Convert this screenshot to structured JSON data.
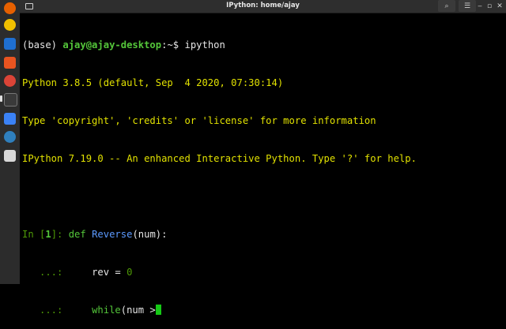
{
  "window": {
    "title": "IPython: home/ajay"
  },
  "dock": {
    "apps": [
      {
        "name": "firefox-icon",
        "color": "#e66000"
      },
      {
        "name": "rhythmbox-icon",
        "color": "#f0c000"
      },
      {
        "name": "libreoffice-writer-icon",
        "color": "#1f6fd0"
      },
      {
        "name": "software-center-icon",
        "color": "#e95420"
      },
      {
        "name": "chrome-icon",
        "color": "#db4437"
      },
      {
        "name": "terminal-icon",
        "color": "#3a3a3a"
      },
      {
        "name": "screenshot-app-icon",
        "color": "#3b82f6"
      },
      {
        "name": "spyder-icon",
        "color": "#2f7fbd"
      },
      {
        "name": "files-icon",
        "color": "#d8d8d8"
      }
    ]
  },
  "terminal": {
    "prompt_env": "(base) ",
    "prompt_user": "ajay@ajay-desktop",
    "prompt_path": ":~$",
    "command": " ipython",
    "banner1": "Python 3.8.5 (default, Sep  4 2020, 07:30:14)",
    "banner2": "Type 'copyright', 'credits' or 'license' for more information",
    "banner3": "IPython 7.19.0 -- An enhanced Interactive Python. Type '?' for help.",
    "in_prefix": "In [",
    "in_number": "1",
    "in_suffix": "]: ",
    "line1": {
      "kw": "def",
      "space": " ",
      "fn": "Reverse",
      "args": "(num):"
    },
    "cont_prompt": "   ...:",
    "line2": {
      "indent": "     ",
      "var": "rev",
      "op": " = ",
      "num": "0"
    },
    "line3": {
      "indent": "     ",
      "kw": "while",
      "rest": "(num >"
    }
  }
}
